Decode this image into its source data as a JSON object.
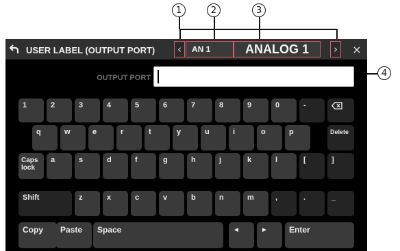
{
  "callouts": {
    "c1": "1",
    "c2": "2",
    "c3": "3",
    "c4": "4"
  },
  "titlebar": {
    "back_icon": "back-arrow-icon",
    "title": "USER LABEL (OUTPUT PORT)",
    "prev_glyph": "‹",
    "port_short": "AN 1",
    "port_name": "ANALOG 1",
    "next_glyph": "›",
    "close_glyph": "×",
    "highlight_color": "#e05a6a"
  },
  "field": {
    "label": "OUTPUT PORT",
    "value": ""
  },
  "keyboard": {
    "rows": {
      "r1": [
        "1",
        "2",
        "3",
        "4",
        "5",
        "6",
        "7",
        "8",
        "9",
        "0",
        "-"
      ],
      "r2": [
        "q",
        "w",
        "e",
        "r",
        "t",
        "y",
        "u",
        "i",
        "o",
        "p",
        "Delete"
      ],
      "r3": [
        "Caps lock",
        "a",
        "s",
        "d",
        "f",
        "g",
        "h",
        "j",
        "k",
        "l",
        "[",
        "]"
      ],
      "r4": [
        "Shift",
        "z",
        "x",
        "c",
        "v",
        "b",
        "n",
        "m",
        ",",
        ".",
        "_"
      ],
      "r5": [
        "Copy",
        "Paste",
        "Space",
        "◄",
        "►",
        "Enter"
      ]
    },
    "backspace_icon": "backspace-icon"
  },
  "colors": {
    "screen_bg": "#000000",
    "key_bg": "#3a3a3a",
    "key_dark_bg": "#242424",
    "title_bg": "#303030"
  }
}
